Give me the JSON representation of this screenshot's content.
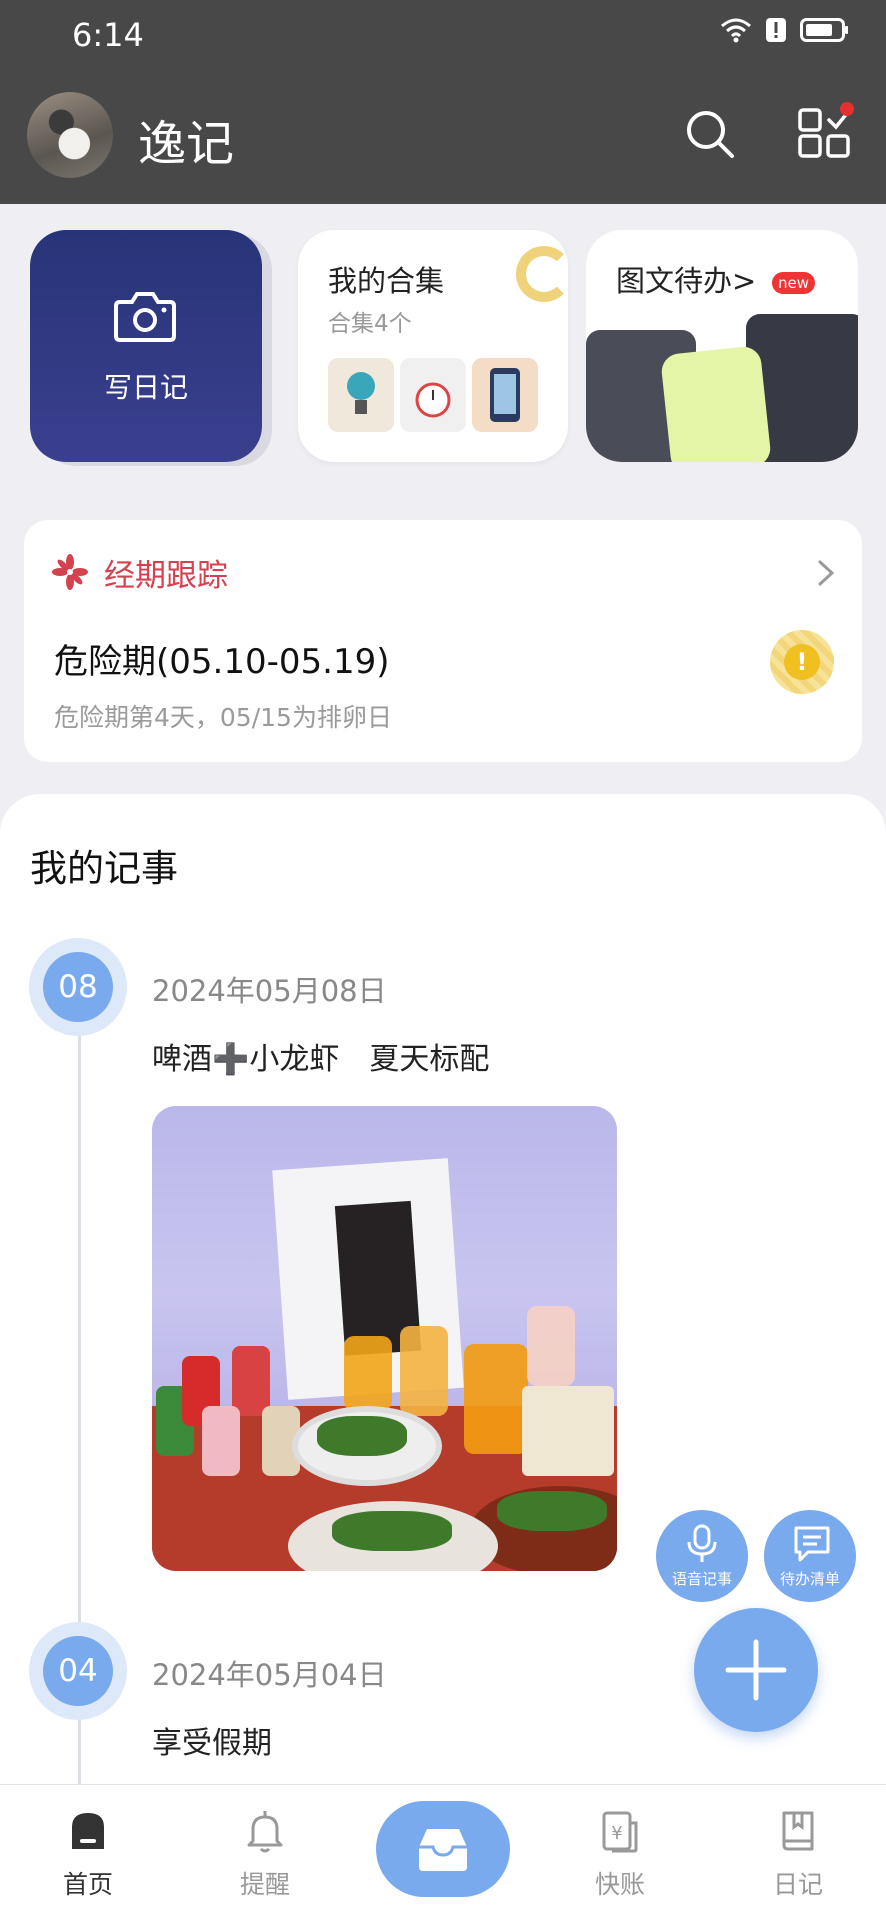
{
  "status": {
    "time": "6:14"
  },
  "header": {
    "title": "逸记",
    "search_icon": "search-icon",
    "apps_icon": "apps-grid-icon"
  },
  "shortcuts": {
    "write": {
      "label": "写日记",
      "icon": "camera-icon"
    },
    "collection": {
      "title": "我的合集",
      "subtitle": "合集4个"
    },
    "todo": {
      "title": "图文待办>",
      "badge": "new"
    }
  },
  "period": {
    "title": "经期跟踪",
    "status": "危险期(05.10-05.19)",
    "detail": "危险期第4天，05/15为排卵日",
    "warn_glyph": "!"
  },
  "notes": {
    "title": "我的记事",
    "entries": [
      {
        "day": "08",
        "date": "2024年05月08日",
        "text": "啤酒➕小龙虾　夏天标配"
      },
      {
        "day": "04",
        "date": "2024年05月04日",
        "text": "享受假期"
      }
    ]
  },
  "fabs": {
    "voice": "语音记事",
    "todo": "待办清单"
  },
  "nav": {
    "home": "首页",
    "remind": "提醒",
    "ledger": "快账",
    "diary": "日记"
  },
  "colors": {
    "accent": "#7aaaee",
    "header_bg": "#484848",
    "period_red": "#d3424e",
    "write_card": "#283478"
  }
}
